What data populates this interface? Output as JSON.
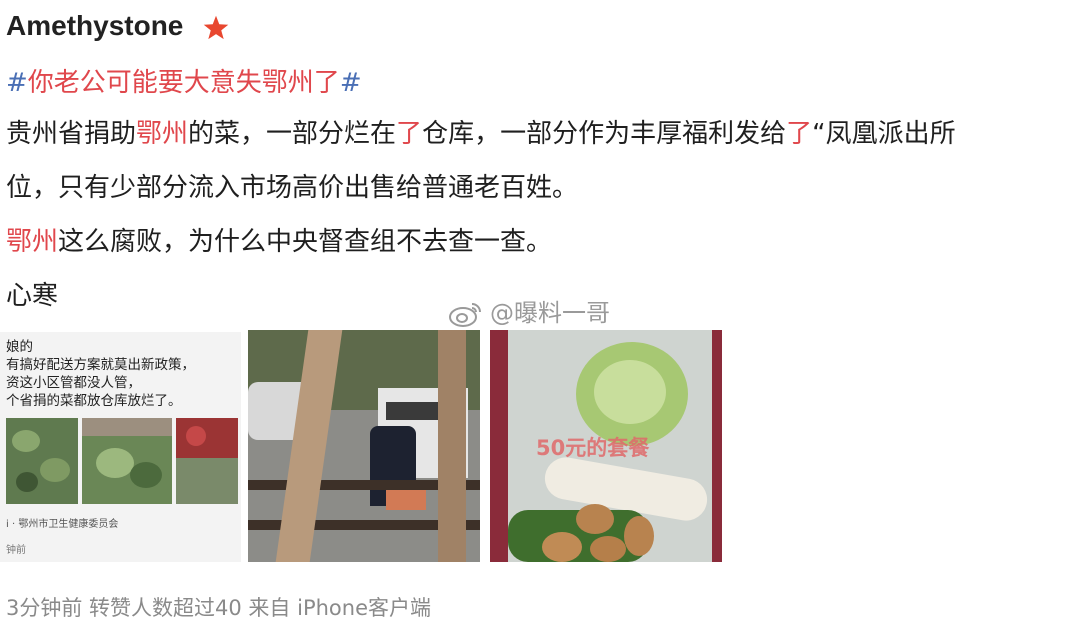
{
  "post": {
    "username": "Amethystone",
    "hashtag_open": "#",
    "hashtag_text": "你老公可能要大意失鄂州了",
    "hashtag_close": "#",
    "line1": [
      "贵州省捐助",
      "鄂州",
      "的菜，一部分烂在",
      "了",
      "仓库，一部分作为丰厚福利发给",
      "了",
      "“凤凰派出所"
    ],
    "line2": "位，只有少部分流入市场高价出售给普通老百姓。",
    "line3": [
      "鄂州",
      "这么腐败，为什么中央督查组不去查一查。"
    ],
    "line4": "心寒",
    "watermark": "@曝料一哥"
  },
  "images": {
    "doc": {
      "lines": [
        "娘的",
        "有搞好配送方案就莫出新政策，",
        "资这小区管都没人管，",
        "个省捐的菜都放仓库放烂了。"
      ],
      "source": "i · 鄂州市卫生健康委员会",
      "time": "钟前"
    },
    "veg_overlay": "50元的套餐"
  },
  "footer": "3分钟前 转赞人数超过40 来自 iPhone客户端",
  "colors": {
    "highlight": "#e0474c",
    "hashtag": "#4a6fb5",
    "footer": "#8a8a8a"
  },
  "icons": {
    "vip": "star-icon",
    "watermark": "weibo-icon"
  }
}
